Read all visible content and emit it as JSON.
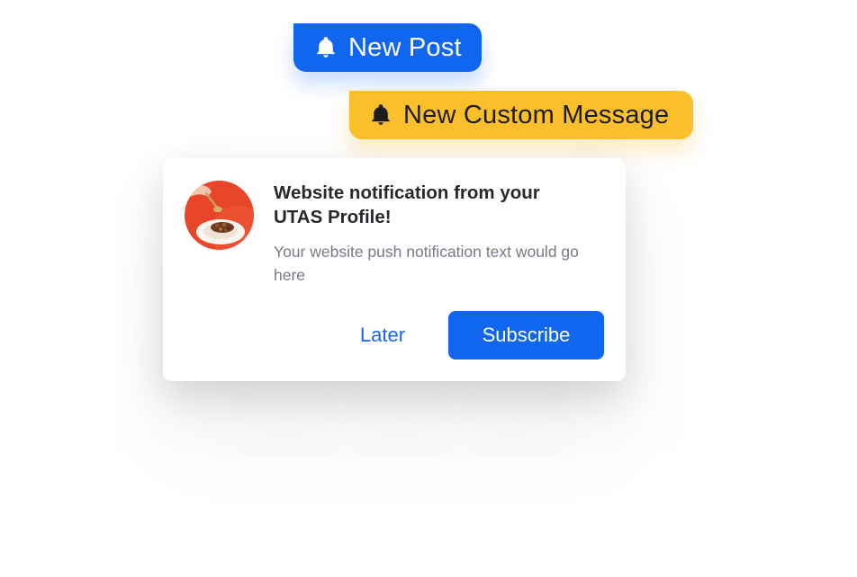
{
  "tags": [
    {
      "label": "New Post",
      "icon": "bell-icon",
      "color": "#1166f0",
      "text_color": "#ffffff"
    },
    {
      "label": "New Custom Message",
      "icon": "bell-icon",
      "color": "#fbbf2b",
      "text_color": "#1d1d1f"
    }
  ],
  "notification": {
    "avatar_icon": "food-plate-image",
    "avatar_color": "#e8462a",
    "title": "Website notification from your UTAS Profile!",
    "body": "Your website push notification text would go here",
    "later_label": "Later",
    "subscribe_label": "Subscribe",
    "accent_color": "#1166f0"
  }
}
